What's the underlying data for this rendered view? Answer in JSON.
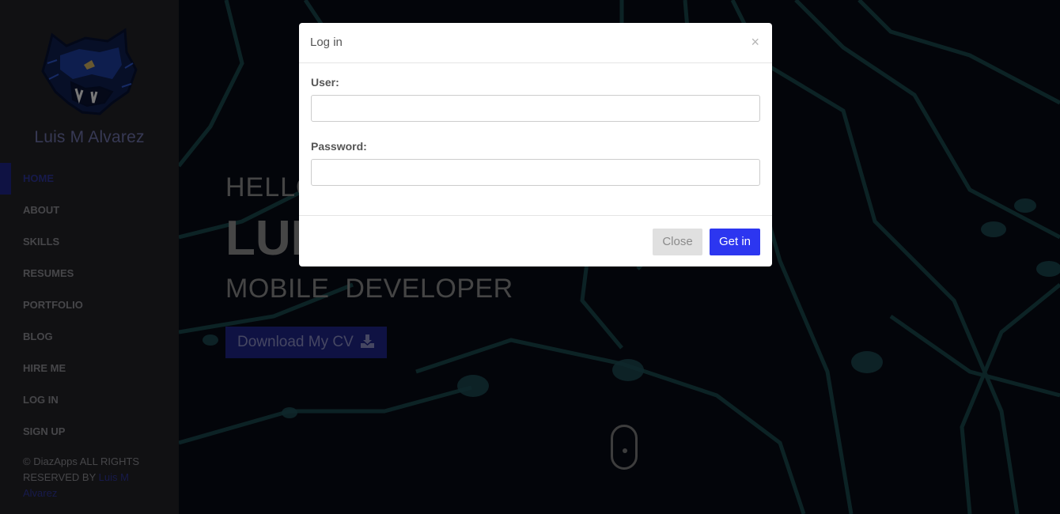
{
  "sidebar": {
    "brand_name": "Luis M Alvarez",
    "nav_items": [
      {
        "label": "HOME",
        "active": true
      },
      {
        "label": "ABOUT",
        "active": false
      },
      {
        "label": "SKILLS",
        "active": false
      },
      {
        "label": "RESUMES",
        "active": false
      },
      {
        "label": "PORTFOLIO",
        "active": false
      },
      {
        "label": "BLOG",
        "active": false
      },
      {
        "label": "HIRE ME",
        "active": false
      },
      {
        "label": "LOG IN",
        "active": false
      },
      {
        "label": "SIGN UP",
        "active": false
      }
    ],
    "copyright_text": "© DiazApps ALL RIGHTS RESERVED BY ",
    "copyright_author": "Luis M Alvarez"
  },
  "hero": {
    "greeting": "HELLO",
    "name": "LUIS",
    "role": "MOBILE  DEVELOPER",
    "cv_button_label": "Download My CV",
    "cv_button_icon": "download-icon",
    "scroll_icon": "mouse-scroll-icon"
  },
  "modal": {
    "title": "Log in",
    "close_symbol": "×",
    "user_label": "User:",
    "user_value": "",
    "password_label": "Password:",
    "password_value": "",
    "close_button_label": "Close",
    "submit_button_label": "Get in"
  },
  "colors": {
    "sidebar_bg": "#222227",
    "accent": "#1e2486",
    "primary_button": "#2c36f0",
    "hero_bg": "#070a14"
  }
}
